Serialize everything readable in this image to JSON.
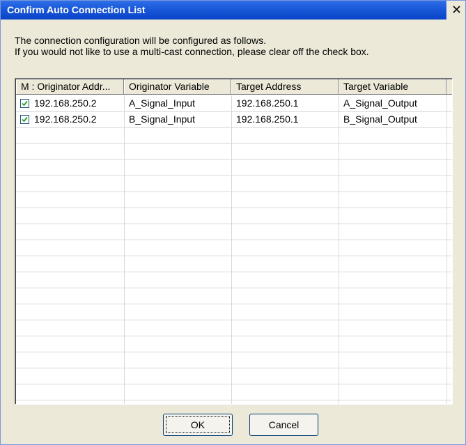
{
  "window": {
    "title": "Confirm Auto Connection List"
  },
  "message": {
    "line1": "The connection configuration will be configured as follows.",
    "line2": "If you would not like to use a multi-cast connection, please clear off the check box."
  },
  "table": {
    "columns": [
      "M : Originator Addr...",
      "Originator Variable",
      "Target Address",
      "Target Variable"
    ],
    "rows": [
      {
        "checked": true,
        "originator_address": "192.168.250.2",
        "originator_variable": "A_Signal_Input",
        "target_address": "192.168.250.1",
        "target_variable": "A_Signal_Output"
      },
      {
        "checked": true,
        "originator_address": "192.168.250.2",
        "originator_variable": "B_Signal_Input",
        "target_address": "192.168.250.1",
        "target_variable": "B_Signal_Output"
      }
    ]
  },
  "buttons": {
    "ok": "OK",
    "cancel": "Cancel"
  },
  "colors": {
    "titlebar": "#0a44c8",
    "dialog_bg": "#ece9d8",
    "checkmark": "#21a121"
  },
  "icons": {
    "close": "close-icon",
    "check": "checkmark-icon"
  }
}
